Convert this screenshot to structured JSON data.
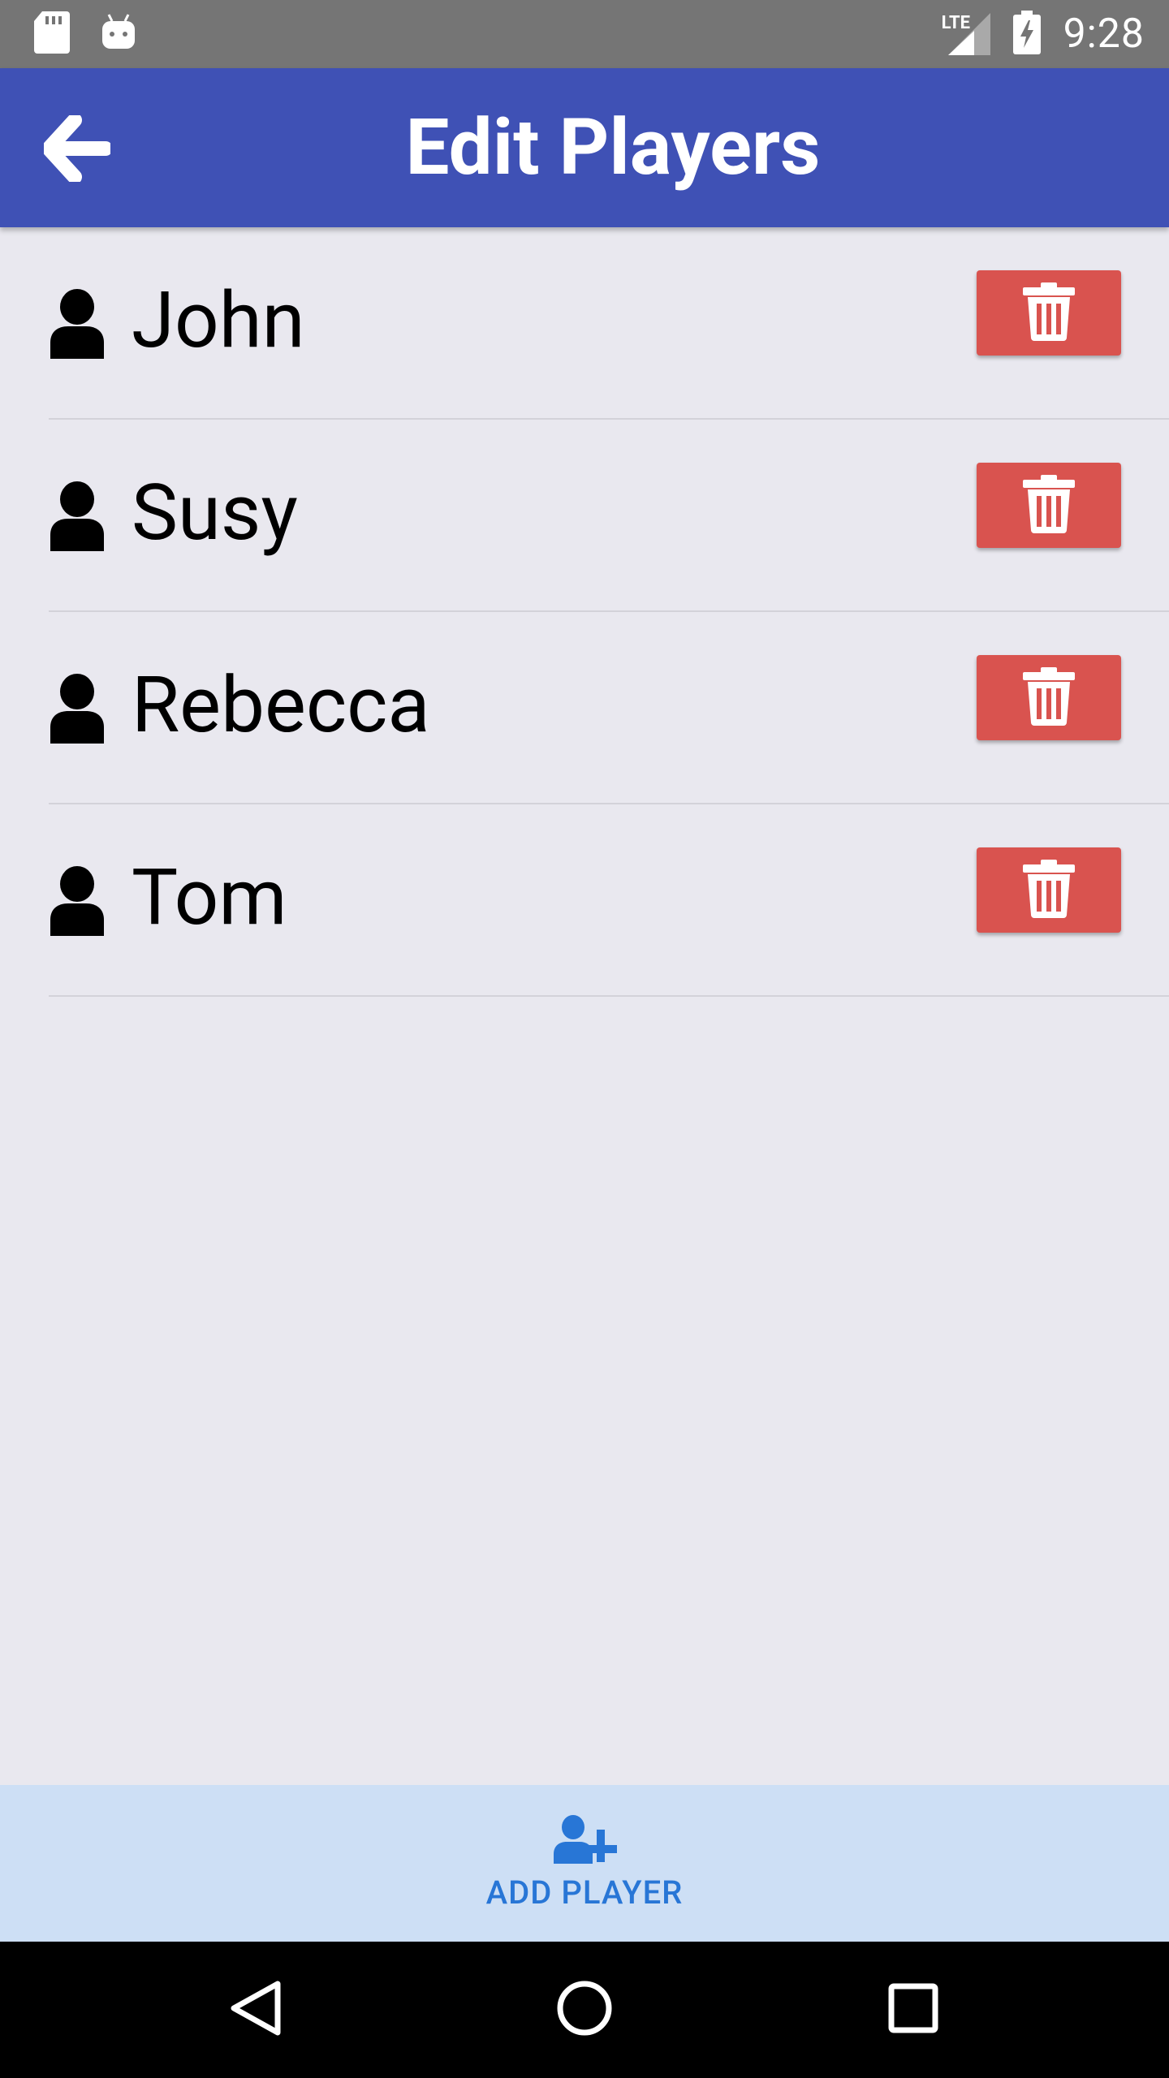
{
  "status_bar": {
    "time": "9:28",
    "network_label": "LTE",
    "left_icons": [
      "sd-card-icon",
      "android-icon"
    ],
    "right_icons": [
      "signal-icon",
      "battery-charging-icon"
    ]
  },
  "app_bar": {
    "title": "Edit Players",
    "back_icon": "arrow-left-icon",
    "color": "#3f51b5"
  },
  "players": [
    {
      "name": "John"
    },
    {
      "name": "Susy"
    },
    {
      "name": "Rebecca"
    },
    {
      "name": "Tom"
    }
  ],
  "delete_button": {
    "icon": "trash-icon",
    "color": "#d9534f"
  },
  "add_player": {
    "label": "ADD PLAYER",
    "icon": "user-plus-icon",
    "accent": "#2876d6",
    "background": "#cddff5"
  },
  "nav_bar": {
    "buttons": [
      "back-triangle-icon",
      "home-circle-icon",
      "recents-square-icon"
    ]
  }
}
